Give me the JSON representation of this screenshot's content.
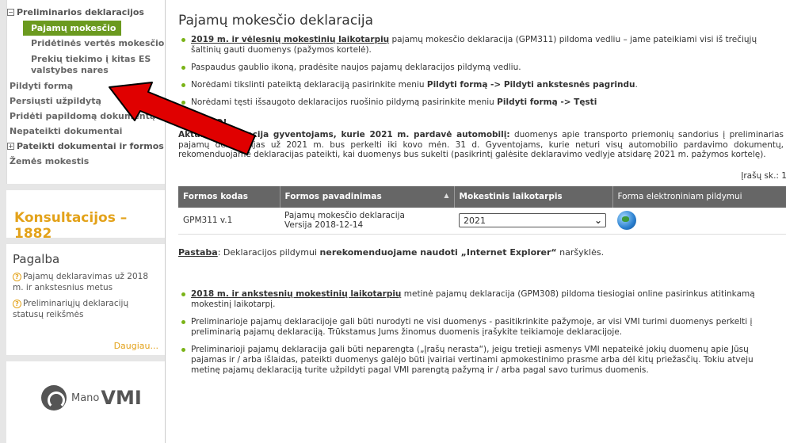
{
  "sidebar": {
    "menu": {
      "parent_label": "Preliminarios deklaracijos",
      "parent_toggle": "−",
      "active_label": "Pajamų mokesčio",
      "sub_items": [
        "Pridėtinės vertės mokesčio",
        "Prekių tiekimo į kitas ES valstybes nares"
      ],
      "items": [
        "Pildyti formą",
        "Persiųsti užpildytą",
        "Pridėti papildomą dokumentą",
        "Nepateikti dokumentai"
      ],
      "parent2_toggle": "+",
      "parent2_label": "Pateikti dokumentai ir formos",
      "last_item": "Žemės mokestis"
    },
    "consult_label": "Konsultacijos – 1882",
    "help": {
      "title": "Pagalba",
      "links": [
        "Pajamų deklaravimas už 2018 m. ir ankstesnius metus",
        "Preliminariųjų deklaracijų statusų reikšmės"
      ],
      "more": "Daugiau..."
    },
    "vmi": {
      "text1": "Mano",
      "text2": "VMI"
    }
  },
  "main": {
    "title": "Pajamų mokesčio deklaracija",
    "b1_link": "2019 m. ir vėlesnių mokestinių laikotarpių",
    "b1_text": " pajamų mokesčio deklaracija (GPM311) pildoma vedliu – jame pateikiami visi iš trečiųjų šaltinių gauti duomenys (pažymos kortelė).",
    "b2": "Paspaudus gaublio ikoną, pradėsite naujos pajamų deklaracijos pildymą vedliu.",
    "b3_pre": "Norėdami tikslinti pateiktą deklaraciją pasirinkite meniu ",
    "b3_bold": "Pildyti formą -> Pildyti ankstesnės pagrindu",
    "b3_post": ".",
    "b4_pre": "Norėdami tęsti išsaugoto deklaracijos ruošinio pildymą pasirinkite meniu ",
    "b4_bold": "Pildyti formą -> Tęsti",
    "attention": "DĖMESIO!",
    "notice_bold": "Aktuali informacija gyventojams, kurie 2021 m. pardavė automobilį:",
    "notice_text": " duomenys apie transporto priemonių sandorius į preliminarias pajamų deklaracijas už 2021 m. bus perkelti iki kovo mėn. 31 d. Gyventojams, kurie neturi visų automobilio pardavimo dokumentų, rekomenduojame deklaracijas pateikti, kai duomenys bus sukelti (pasikrintį galėsite deklaravimo vedlyje atsidarę 2021 m. pažymos kortelę).",
    "count": "Įrašų sk.: 1",
    "table": {
      "headers": [
        "Formos kodas",
        "Formos pavadinimas",
        "Mokestinis laikotarpis",
        "Forma elektroniniam pildymui"
      ],
      "sort_icon": "▲",
      "row": {
        "code": "GPM311 v.1",
        "name": "Pajamų mokesčio deklaracija",
        "version": "Versija 2018-12-14",
        "period": "2021",
        "chevron": "⌄"
      }
    },
    "note_u": "Pastaba",
    "note_pre": ": Deklaracijos pildymui ",
    "note_bold": "nerekomenduojame naudoti „Internet Explorer“",
    "note_post": " naršyklės.",
    "b5_link": "2018 m. ir ankstesnių mokestinių laikotarpių",
    "b5_text": " metinė pajamų deklaracija (GPM308) pildoma tiesiogiai online pasirinkus atitinkamą mokestinį laikotarpį.",
    "b6": "Preliminarioje pajamų deklaracijoje gali būti nurodyti ne visi duomenys - pasitikrinkite pažymoje, ar visi VMI turimi duomenys perkelti į preliminarią pajamų deklaraciją. Trūkstamus Jums žinomus duomenis įrašykite teikiamoje deklaracijoje.",
    "b7": "Preliminarioji pajamų deklaracija gali būti neparengta („Įrašų nerasta“), jeigu tretieji asmenys VMI nepateikė jokių duomenų apie Jūsų pajamas ir / arba išlaidas, pateikti duomenys galėjo būti įvairiai vertinami apmokestinimo prasme arba dėl kitų priežasčių. Tokiu atveju metinę pajamų deklaraciją turite užpildyti pagal VMI parengtą pažymą ir / arba pagal savo turimus duomenis."
  },
  "colors": {
    "accent_green": "#6b9a1f",
    "orange": "#e3a21a",
    "table_header": "#666666",
    "arrow": "#e00000"
  }
}
